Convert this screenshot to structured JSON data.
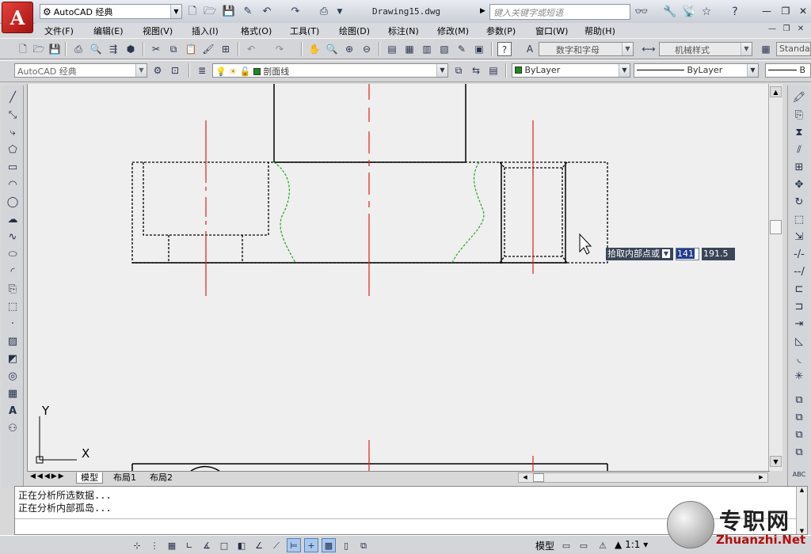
{
  "titlebar": {
    "workspace": "AutoCAD 经典",
    "document_title": "Drawing15.dwg",
    "search_placeholder": "键入关键字或短语"
  },
  "menu": [
    "文件(F)",
    "编辑(E)",
    "视图(V)",
    "插入(I)",
    "格式(O)",
    "工具(T)",
    "绘图(D)",
    "标注(N)",
    "修改(M)",
    "参数(P)",
    "窗口(W)",
    "帮助(H)"
  ],
  "styles_toolbar": {
    "text_style": "数字和字母",
    "dim_style": "机械样式",
    "table_style": "Standa"
  },
  "layers_toolbar": {
    "workspace": "AutoCAD 经典",
    "current_layer": "剖面线",
    "layer_color": "#1b8a1b",
    "color": "ByLayer",
    "linetype": "ByLayer",
    "lineweight": "B"
  },
  "tabs": [
    "模型",
    "布局1",
    "布局2"
  ],
  "command": {
    "lines": [
      "正在分析所选数据...",
      "正在分析内部孤岛..."
    ],
    "input": ""
  },
  "dynamic_input": {
    "prompt": "拾取内部点或",
    "x_value": "141",
    "y_value": "191.5"
  },
  "status": {
    "model_label": "模型",
    "scale": "1:1"
  },
  "ucs": {
    "x_label": "X",
    "y_label": "Y"
  },
  "watermark": {
    "text": "专职网",
    "url": "Zhuanzhi.Net"
  },
  "colors": {
    "centerline": "#e02020",
    "hatch_boundary": "#1aa51a",
    "outline": "#000000",
    "canvas_bg": "#efefef",
    "logo_red": "#c8221c"
  }
}
